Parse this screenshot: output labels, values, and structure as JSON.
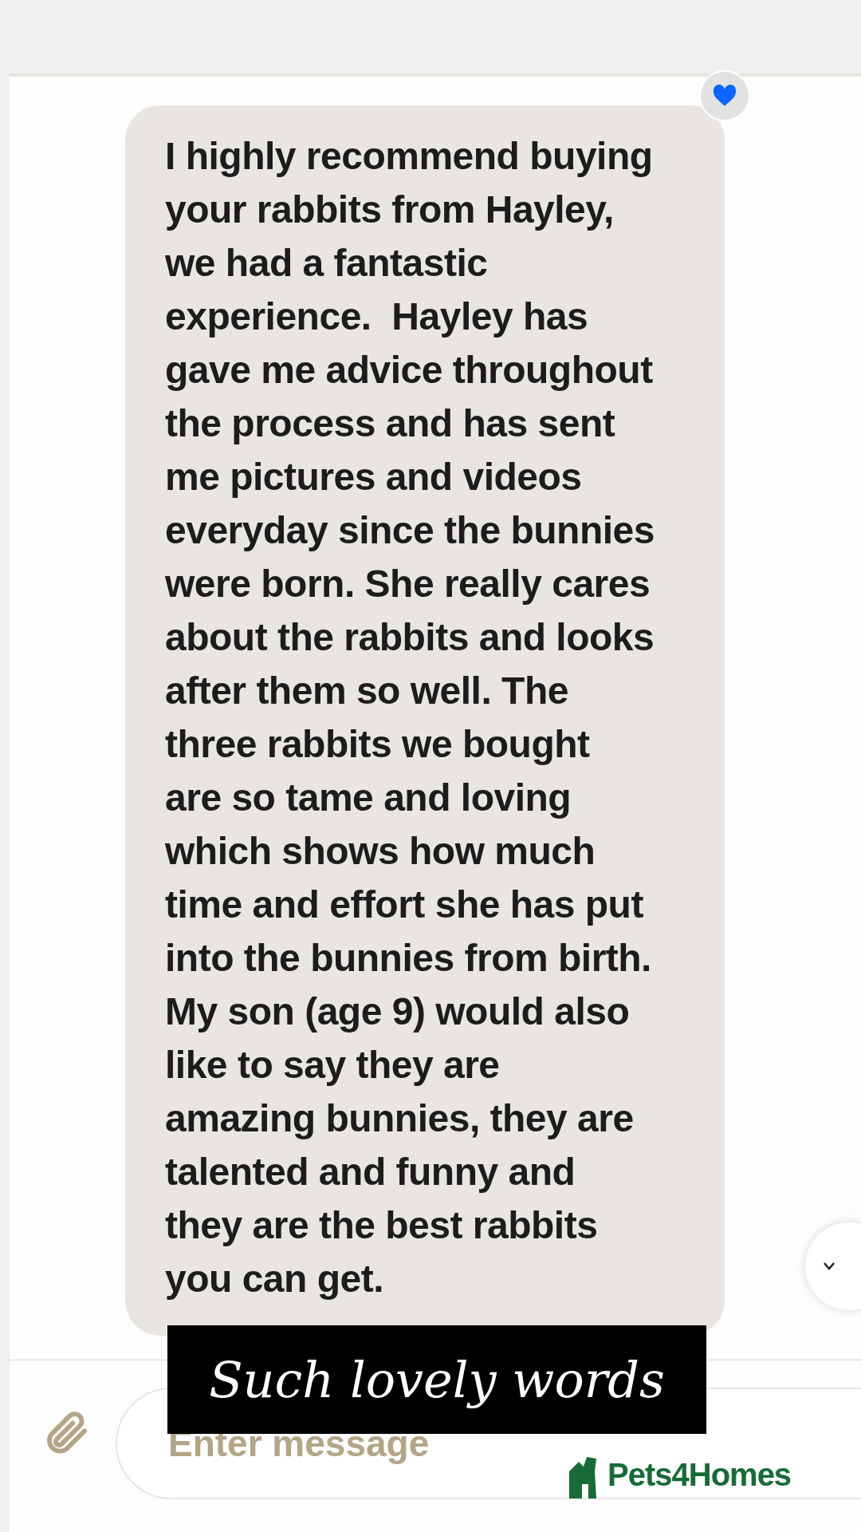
{
  "message": {
    "text": "I highly recommend buying\nyour rabbits from Hayley,\nwe had a fantastic\nexperience.  Hayley has\ngave me advice throughout\nthe process and has sent\nme pictures and videos\neveryday since the bunnies\nwere born. She really cares\nabout the rabbits and looks\nafter them so well. The\nthree rabbits we bought\nare so tame and loving\nwhich shows how much\ntime and effort she has put\ninto the bunnies from birth.\nMy son (age 9) would also\nlike to say they are\namazing bunnies, they are\ntalented and funny and\nthey are the best rabbits\nyou can get.",
    "liked": true
  },
  "caption": "Such lovely words",
  "composer": {
    "placeholder": "Enter message"
  },
  "logo": "Pets4Homes"
}
